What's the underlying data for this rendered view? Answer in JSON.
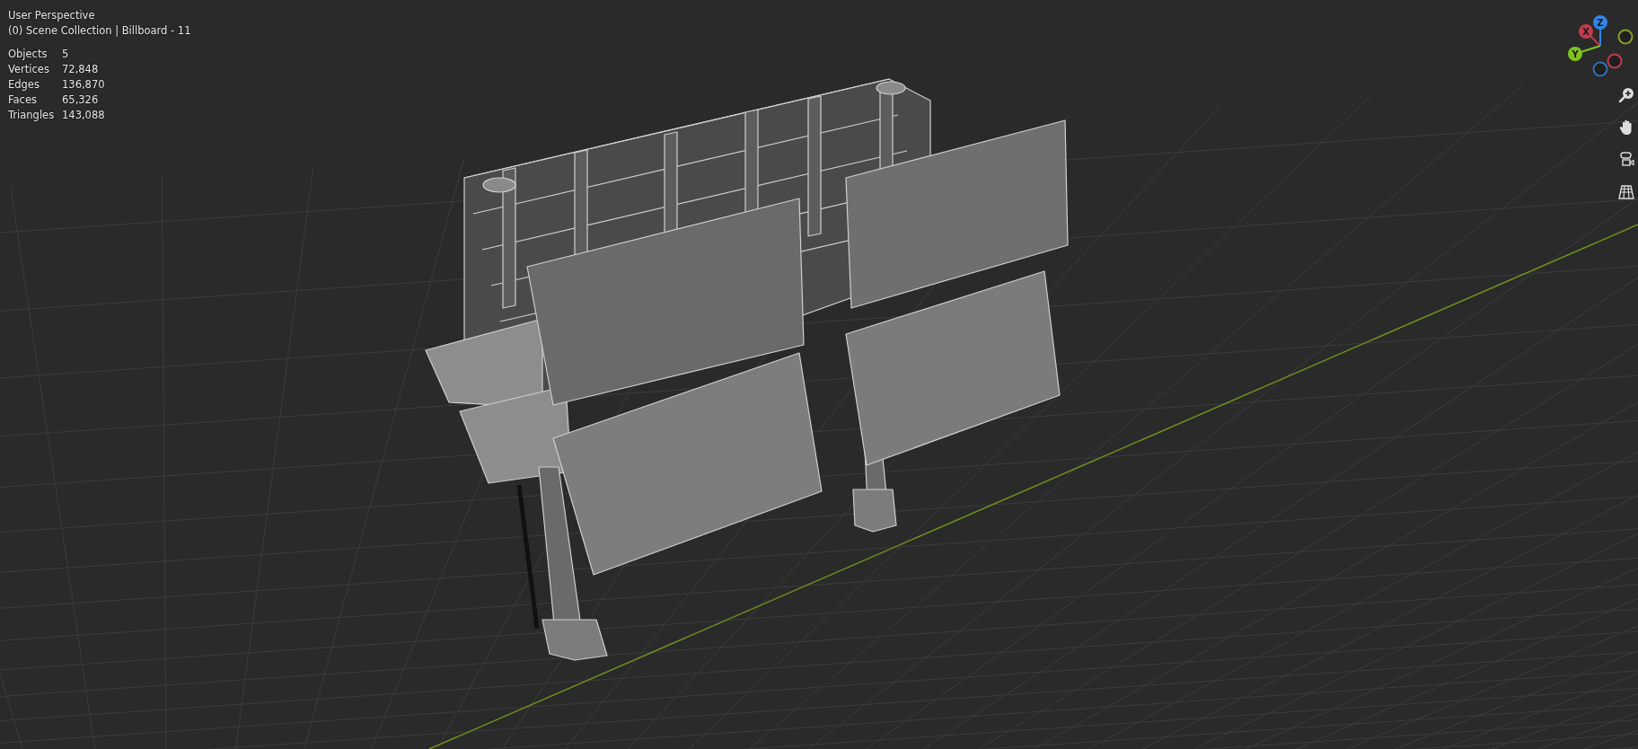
{
  "viewport": {
    "view_name": "User Perspective",
    "context": "(0) Scene Collection | Billboard - 11"
  },
  "stats": [
    {
      "label": "Objects",
      "value": "5"
    },
    {
      "label": "Vertices",
      "value": "72,848"
    },
    {
      "label": "Edges",
      "value": "136,870"
    },
    {
      "label": "Faces",
      "value": "65,326"
    },
    {
      "label": "Triangles",
      "value": "143,088"
    }
  ],
  "gizmo": {
    "axes": [
      {
        "kind": "negative",
        "color": "#c23a4e"
      },
      {
        "kind": "negative",
        "color": "#2f6fb8"
      },
      {
        "kind": "negative",
        "color": "#7fa52a"
      },
      {
        "kind": "positive",
        "label": "X",
        "color": "#c23a4e"
      },
      {
        "kind": "positive",
        "label": "Y",
        "color": "#7fc21c"
      },
      {
        "kind": "positive",
        "label": "Z",
        "color": "#2f86e8"
      }
    ]
  }
}
